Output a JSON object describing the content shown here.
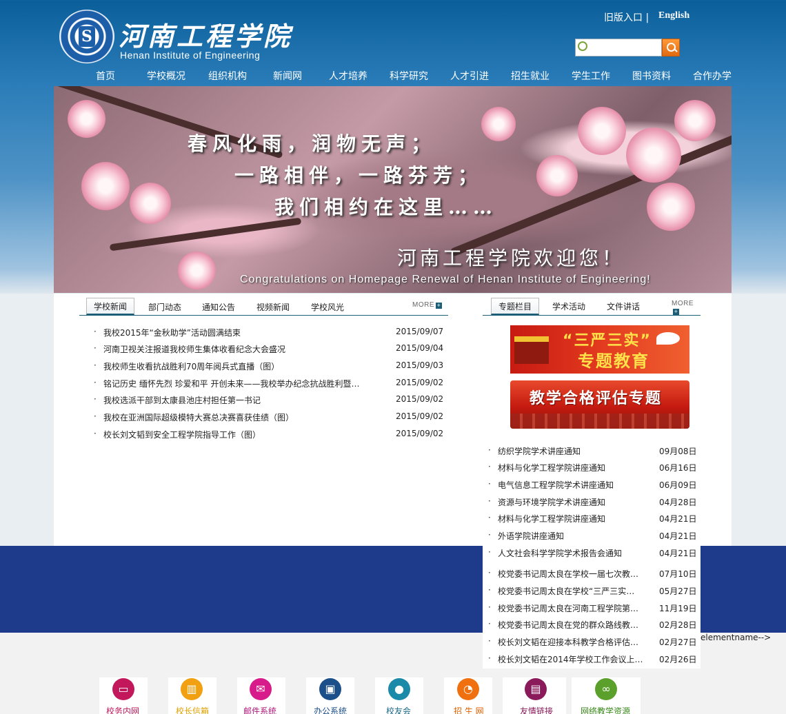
{
  "header": {
    "school_name_cn": "河南工程学院",
    "school_name_en": "Henan Institute of Engineering",
    "old_version": "旧版入口 |",
    "english": "English",
    "search_placeholder": ""
  },
  "nav": [
    "首页",
    "学校概况",
    "组织机构",
    "新闻网",
    "人才培养",
    "科学研究",
    "人才引进",
    "招生就业",
    "学生工作",
    "图书资料",
    "合作办学"
  ],
  "banner": {
    "line1": "春风化雨，润物无声；",
    "line2": "一路相伴，一路芬芳；",
    "line3": "我们相约在这里……",
    "welcome": "河南工程学院欢迎您！",
    "congrats": "Congratulations on Homepage Renewal of Henan Institute of Engineering!"
  },
  "news": {
    "tabs": [
      "学校新闻",
      "部门动态",
      "通知公告",
      "视频新闻",
      "学校风光"
    ],
    "more": "MORE",
    "items": [
      {
        "title": "我校2015年“金秋助学”活动圆满结束",
        "date": "2015/09/07"
      },
      {
        "title": "河南卫视关注报道我校师生集体收看纪念大会盛况",
        "date": "2015/09/04"
      },
      {
        "title": "我校师生收看抗战胜利70周年阅兵式直播（图）",
        "date": "2015/09/03"
      },
      {
        "title": "铭记历史 缅怀先烈 珍爱和平 开创未来——我校举办纪念抗战胜利暨…",
        "date": "2015/09/02"
      },
      {
        "title": "我校选派干部到太康县池庄村担任第一书记",
        "date": "2015/09/02"
      },
      {
        "title": "我校在亚洲国际超级模特大赛总决赛喜获佳绩（图）",
        "date": "2015/09/02"
      },
      {
        "title": "校长刘文韬到安全工程学院指导工作（图）",
        "date": "2015/09/02"
      }
    ]
  },
  "topics": {
    "tabs": [
      "专题栏目",
      "学术活动",
      "文件讲话"
    ],
    "more": "MORE",
    "promo1_line1": "“三严三实”",
    "promo1_line2": "专题教育",
    "promo2": "教学合格评估专题",
    "items": [
      {
        "title": "纺织学院学术讲座通知",
        "date": "09月08日"
      },
      {
        "title": "材料与化学工程学院讲座通知",
        "date": "06月16日"
      },
      {
        "title": "电气信息工程学院学术讲座通知",
        "date": "06月09日"
      },
      {
        "title": "资源与环境学院学术讲座通知",
        "date": "04月28日"
      },
      {
        "title": "材料与化学工程学院讲座通知",
        "date": "04月21日"
      },
      {
        "title": "外语学院讲座通知",
        "date": "04月21日"
      },
      {
        "title": "人文社会科学学院学术报告会通知",
        "date": "04月21日"
      }
    ],
    "items2": [
      {
        "title": "校党委书记周太良在学校一届七次教…",
        "date": "07月10日"
      },
      {
        "title": "校党委书记周太良在学校“三严三实…",
        "date": "05月27日"
      },
      {
        "title": "校党委书记周太良在河南工程学院第…",
        "date": "11月19日"
      },
      {
        "title": "校党委书记周太良在党的群众路线教…",
        "date": "02月28日"
      },
      {
        "title": "校长刘文韬在迎接本科教学合格评估…",
        "date": "02月27日"
      },
      {
        "title": "校长刘文韬在2014年学校工作会议上…",
        "date": "02月26日"
      }
    ]
  },
  "stray_text": "elementname-->",
  "quick_links": [
    {
      "label": "校务内网",
      "icon": "monitor-icon",
      "color": "#c2185b",
      "text_color": "#c2185b"
    },
    {
      "label": "校长信箱",
      "icon": "books-icon",
      "color": "#f0a010",
      "text_color": "#e0a000"
    },
    {
      "label": "邮件系统",
      "icon": "mail-icon",
      "color": "#d81b8a",
      "text_color": "#b0187a"
    },
    {
      "label": "办公系统",
      "icon": "briefcase-icon",
      "color": "#1a4f8a",
      "text_color": "#1a4f8a"
    },
    {
      "label": "校友会",
      "icon": "user-icon",
      "color": "#1a8aa8",
      "text_color": "#1a6a88"
    },
    {
      "label": "招 生 网",
      "icon": "rss-icon",
      "color": "#f07010",
      "text_color": "#e06000"
    },
    {
      "label": "友情链接",
      "icon": "book-icon",
      "color": "#8a1a5a",
      "text_color": "#8a1a5a"
    },
    {
      "label": "网络教学资源",
      "icon": "link-icon",
      "color": "#5aa02a",
      "text_color": "#3a8a1a"
    }
  ]
}
